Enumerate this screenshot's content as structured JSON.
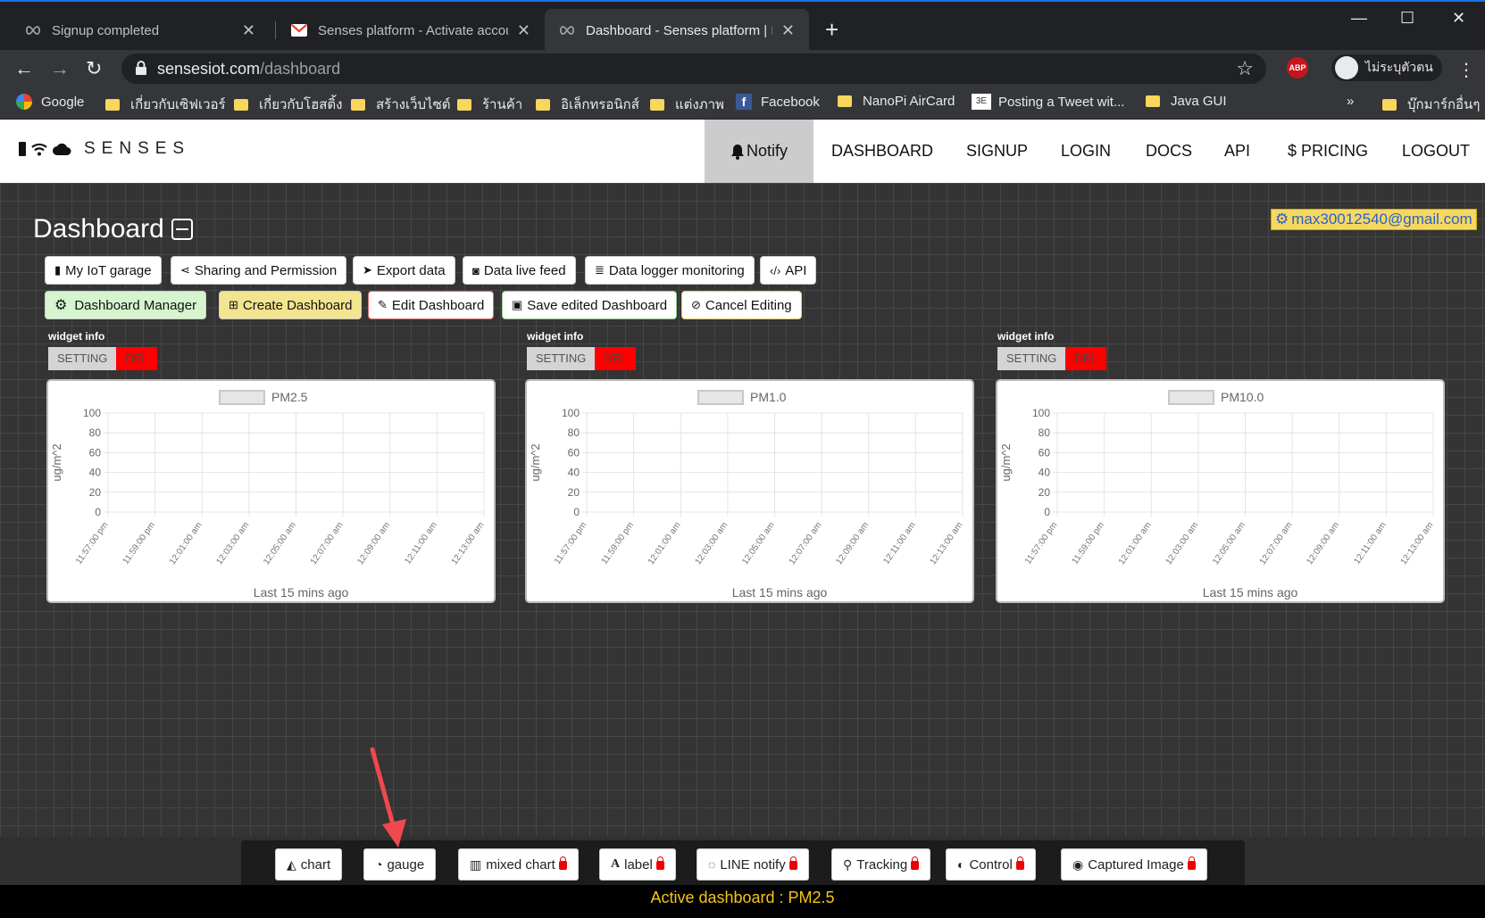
{
  "browser": {
    "tabs": [
      {
        "title": "Signup completed",
        "active": false
      },
      {
        "title": "Senses platform - Activate accou",
        "active": false
      },
      {
        "title": "Dashboard - Senses platform | In",
        "active": true
      }
    ],
    "new_tab": "+",
    "window_controls": {
      "minimize": "—",
      "maximize": "☐",
      "close": "✕"
    },
    "url_host": "sensesiot.com",
    "url_path": "/dashboard",
    "profile_label": "ไม่ระบุตัวตน",
    "abp_label": "ABP",
    "bookmarks": [
      {
        "label": "Google",
        "icon": "google-icon"
      },
      {
        "label": "เกี่ยวกับเซิฟเวอร์",
        "icon": "folder-icon"
      },
      {
        "label": "เกี่ยวกับโฮสติ้ง",
        "icon": "folder-icon"
      },
      {
        "label": "สร้างเว็บไซต์",
        "icon": "folder-icon"
      },
      {
        "label": "ร้านค้า",
        "icon": "folder-icon"
      },
      {
        "label": "อิเล็กทรอนิกส์",
        "icon": "folder-icon"
      },
      {
        "label": "แต่งภาพ",
        "icon": "folder-icon"
      },
      {
        "label": "Facebook",
        "icon": "facebook-icon"
      },
      {
        "label": "NanoPi AirCard",
        "icon": "folder-icon"
      },
      {
        "label": "Posting a Tweet wit...",
        "icon": "tweet-icon"
      },
      {
        "label": "Java GUI",
        "icon": "folder-icon"
      }
    ],
    "bookmarks_overflow": "»",
    "other_bookmarks": "บุ๊กมาร์กอื่นๆ"
  },
  "site": {
    "brand": "SENSES",
    "nav": [
      "Notify",
      "DASHBOARD",
      "SIGNUP",
      "LOGIN",
      "DOCS",
      "API",
      "$ PRICING",
      "LOGOUT"
    ]
  },
  "dashboard": {
    "title": "Dashboard",
    "user_email": "max30012540@gmail.com",
    "row1_buttons": [
      "My IoT garage",
      "Sharing and Permission",
      "Export data",
      "Data live feed",
      "Data logger monitoring",
      "API"
    ],
    "row2_buttons": [
      "Dashboard Manager",
      "Create Dashboard",
      "Edit Dashboard",
      "Save edited Dashboard",
      "Cancel Editing"
    ],
    "widget_info_label": "widget info",
    "setting_label": "SETTING",
    "del_label": "DEL"
  },
  "chart_data": [
    {
      "type": "line",
      "legend": "PM2.5",
      "ylabel": "ug/m^2",
      "xlabel": "Last 15 mins ago",
      "yticks": [
        0,
        20,
        40,
        60,
        80,
        100
      ],
      "ylim": [
        0,
        100
      ],
      "categories": [
        "11:57:00 pm",
        "11:59:00 pm",
        "12:01:00 am",
        "12:03:00 am",
        "12:05:00 am",
        "12:07:00 am",
        "12:09:00 am",
        "12:11:00 am",
        "12:13:00 am"
      ],
      "series": []
    },
    {
      "type": "line",
      "legend": "PM1.0",
      "ylabel": "ug/m^2",
      "xlabel": "Last 15 mins ago",
      "yticks": [
        0,
        20,
        40,
        60,
        80,
        100
      ],
      "ylim": [
        0,
        100
      ],
      "categories": [
        "11:57:00 pm",
        "11:59:00 pm",
        "12:01:00 am",
        "12:03:00 am",
        "12:05:00 am",
        "12:07:00 am",
        "12:09:00 am",
        "12:11:00 am",
        "12:13:00 am"
      ],
      "series": []
    },
    {
      "type": "line",
      "legend": "PM10.0",
      "ylabel": "ug/m^2",
      "xlabel": "Last 15 mins ago",
      "yticks": [
        0,
        20,
        40,
        60,
        80,
        100
      ],
      "ylim": [
        0,
        100
      ],
      "categories": [
        "11:57:00 pm",
        "11:59:00 pm",
        "12:01:00 am",
        "12:03:00 am",
        "12:05:00 am",
        "12:07:00 am",
        "12:09:00 am",
        "12:11:00 am",
        "12:13:00 am"
      ],
      "series": []
    }
  ],
  "toolbar": {
    "widgets": [
      "chart",
      "gauge",
      "mixed chart",
      "label",
      "LINE notify",
      "Tracking",
      "Control",
      "Captured Image"
    ],
    "active_dashboard": "Active dashboard : PM2.5"
  },
  "colors": {
    "accent_yellow": "#f5c518",
    "del_red": "#ff0000",
    "annotation_arrow": "#f0484f"
  }
}
